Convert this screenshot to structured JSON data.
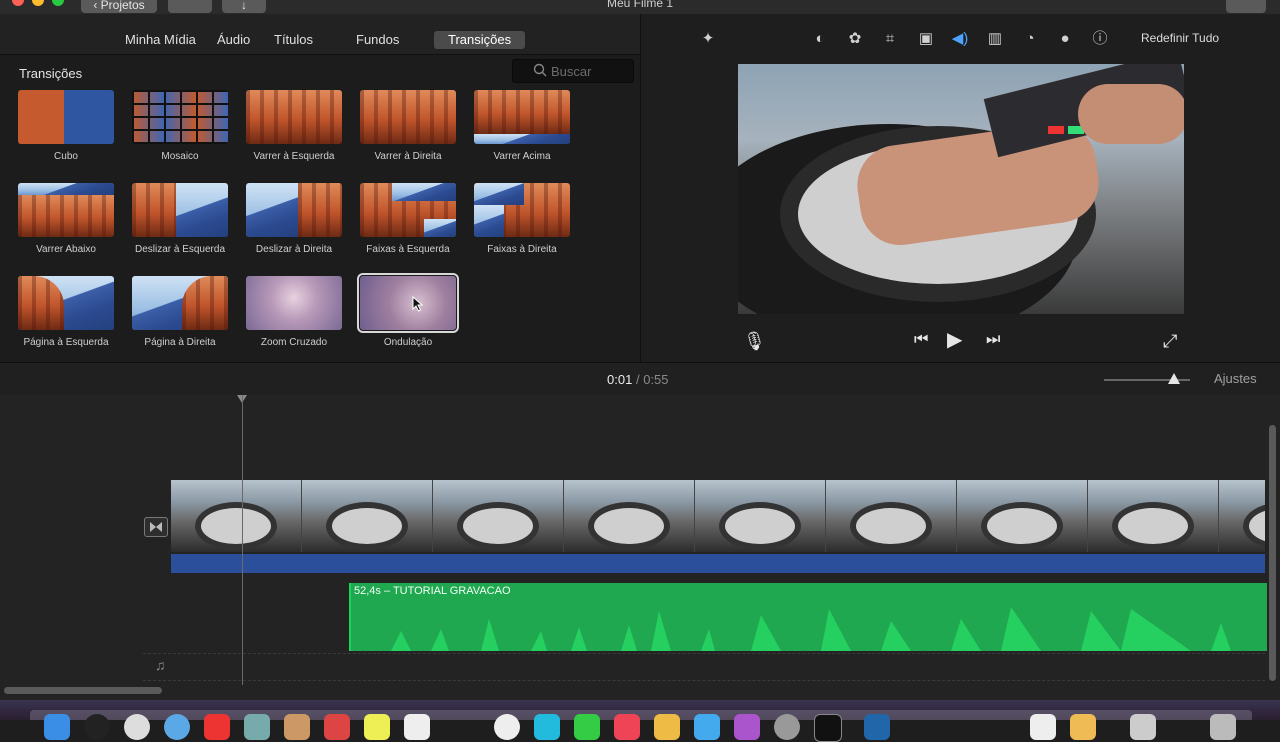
{
  "window": {
    "title": "Meu Filme 1",
    "projects_button": "Projetos",
    "traffic_colors": [
      "#ff5f57",
      "#febc2e",
      "#28c840"
    ]
  },
  "browser": {
    "tabs": [
      {
        "label": "Minha Mídia"
      },
      {
        "label": "Áudio"
      },
      {
        "label": "Títulos"
      },
      {
        "label": "Fundos"
      },
      {
        "label": "Transições",
        "active": true
      }
    ],
    "section_title": "Transições",
    "search_placeholder": "Buscar",
    "transitions": [
      {
        "label": "Cubo"
      },
      {
        "label": "Mosaico"
      },
      {
        "label": "Varrer à Esquerda"
      },
      {
        "label": "Varrer à Direita"
      },
      {
        "label": "Varrer Acima"
      },
      {
        "label": "Varrer Abaixo"
      },
      {
        "label": "Deslizar à Esquerda"
      },
      {
        "label": "Deslizar à Direita"
      },
      {
        "label": "Faixas à Esquerda"
      },
      {
        "label": "Faixas à Direita"
      },
      {
        "label": "Página à Esquerda"
      },
      {
        "label": "Página à Direita"
      },
      {
        "label": "Zoom Cruzado"
      },
      {
        "label": "Ondulação",
        "selected": true
      }
    ]
  },
  "viewer": {
    "tools": [
      "magic-wand-icon",
      "color-balance-icon",
      "color-palette-icon",
      "crop-icon",
      "stabilization-icon",
      "volume-icon",
      "equalizer-icon",
      "speed-icon",
      "noise-filter-icon",
      "info-icon"
    ],
    "reset_label": "Redefinir Tudo"
  },
  "timeline": {
    "current_time": "0:01",
    "separator": "/",
    "total_time": "0:55",
    "settings_label": "Ajustes",
    "audio_clip_label": "52,4s – TUTORIAL GRAVACAO"
  },
  "colors": {
    "accent_blue": "#2b4f9a",
    "audio_green": "#1fa84f"
  }
}
